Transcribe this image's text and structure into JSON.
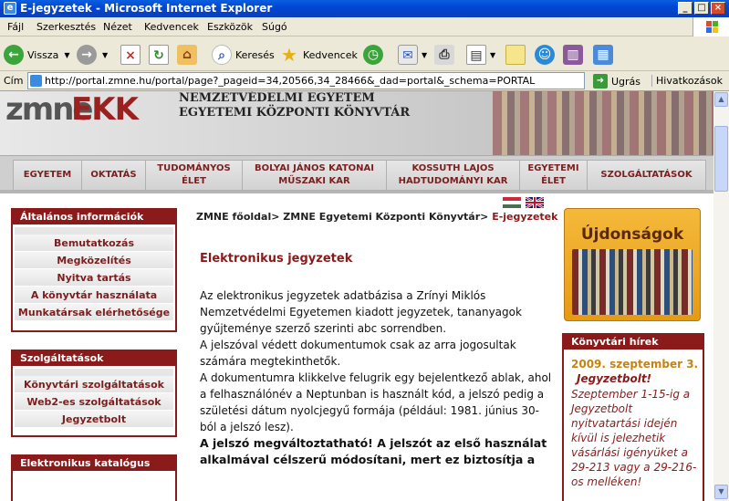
{
  "window": {
    "title": "E-jegyzetek - Microsoft Internet Explorer"
  },
  "menu": [
    "Fájl",
    "Szerkesztés",
    "Nézet",
    "Kedvencek",
    "Eszközök",
    "Súgó"
  ],
  "toolbar": {
    "back": "Vissza",
    "search": "Keresés",
    "favorites": "Kedvencek"
  },
  "address": {
    "label": "Cím",
    "url": "http://portal.zmne.hu/portal/page?_pageid=34,20566,34_28466&_dad=portal&_schema=PORTAL",
    "go": "Ugrás",
    "links": "Hivatkozások"
  },
  "header": {
    "inst_line1": "NEMZETVÉDELMI EGYETEM",
    "inst_line2": "EGYETEMI KÖZPONTI KÖNYVTÁR",
    "logo_left": "zmne",
    "logo_right": "EKK"
  },
  "nav": [
    "EGYETEM",
    "OKTATÁS",
    "TUDOMÁNYOS ÉLET",
    "BOLYAI JÁNOS KATONAI MŰSZAKI KAR",
    "KOSSUTH LAJOS HADTUDOMÁNYI KAR",
    "EGYETEMI ÉLET",
    "SZOLGÁLTATÁSOK"
  ],
  "sidebar": {
    "box1": {
      "title": "Általános információk",
      "items": [
        "Bemutatkozás",
        "Megközelítés",
        "Nyitva tartás",
        "A könyvtár használata",
        "Munkatársak elérhetősége"
      ]
    },
    "box2": {
      "title": "Szolgáltatások",
      "items": [
        "Könyvtári szolgáltatások",
        "Web2-es szolgáltatások",
        "Jegyzetbolt"
      ]
    },
    "box3": {
      "title": "Elektronikus katalógus"
    }
  },
  "breadcrumb": {
    "part1": "ZMNE főoldal",
    "sep": ">",
    "part2": "ZMNE Egyetemi Központi Könyvtár",
    "current": "E-jegyzetek"
  },
  "main": {
    "title": "Elektronikus jegyzetek",
    "p1": "Az elektronikus jegyzetek adatbázisa a Zrínyi Miklós Nemzetvédelmi Egyetemen kiadott jegyzetek, tananyagok gyűjteménye szerző szerinti abc sorrendben.",
    "p2": "A jelszóval védett dokumentumok csak az arra jogosultak számára megtekinthetők.",
    "p3": "A dokumentumra klikkelve felugrik egy bejelentkező ablak, ahol a felhasználónév a Neptunban is használt kód, a jelszó pedig a születési dátum nyolcjegyű formája (például: 1981. június 30-ból a jelszó lesz).",
    "p4": "A jelszó megváltoztatható! A jelszót az első használat alkalmával célszerű módosítani, mert ez biztosítja a"
  },
  "right": {
    "ujdonsagok": "Újdonságok",
    "news_title": "Könyvtári hírek",
    "news_date": "2009. szeptember 3.",
    "news_headline": "Jegyzetbolt!",
    "news_text": "Szeptember 1-15-ig a Jegyzetbolt nyitvatartási idején kívül is jelezhetik vásárlási igényüket a 29-213 vagy a 29-216-os melléken!"
  }
}
